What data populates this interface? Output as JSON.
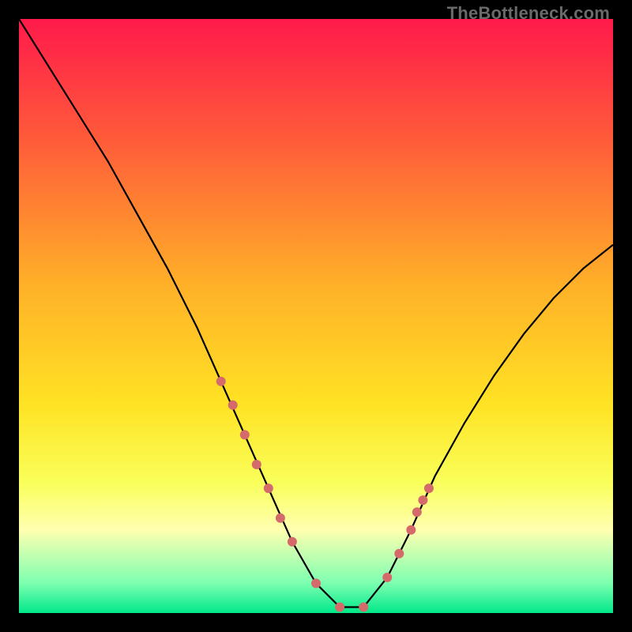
{
  "watermark": "TheBottleneck.com",
  "chart_data": {
    "type": "line",
    "title": "",
    "xlabel": "",
    "ylabel": "",
    "xlim": [
      0,
      100
    ],
    "ylim": [
      0,
      100
    ],
    "series": [
      {
        "name": "bottleneck-curve",
        "x": [
          0,
          5,
          10,
          15,
          20,
          25,
          30,
          34,
          38,
          42,
          46,
          50,
          54,
          58,
          62,
          66,
          70,
          75,
          80,
          85,
          90,
          95,
          100
        ],
        "y": [
          100,
          92,
          84,
          76,
          67,
          58,
          48,
          39,
          30,
          21,
          12,
          5,
          1,
          1,
          6,
          14,
          23,
          32,
          40,
          47,
          53,
          58,
          62
        ]
      }
    ],
    "markers": {
      "name": "highlight-points",
      "color": "#d46a6a",
      "x": [
        34,
        36,
        38,
        40,
        42,
        44,
        46,
        50,
        54,
        58,
        62,
        64,
        66,
        67,
        68,
        69
      ],
      "y": [
        39,
        35,
        30,
        25,
        21,
        16,
        12,
        5,
        1,
        1,
        6,
        10,
        14,
        17,
        19,
        21
      ]
    },
    "background_gradient": {
      "stops": [
        {
          "offset": 0.0,
          "color": "#ff1a4b"
        },
        {
          "offset": 0.2,
          "color": "#ff5a3a"
        },
        {
          "offset": 0.45,
          "color": "#ffb128"
        },
        {
          "offset": 0.65,
          "color": "#ffe324"
        },
        {
          "offset": 0.78,
          "color": "#f9ff5a"
        },
        {
          "offset": 0.86,
          "color": "#ffffb0"
        },
        {
          "offset": 0.95,
          "color": "#7cffb0"
        },
        {
          "offset": 1.0,
          "color": "#00e88a"
        }
      ]
    }
  }
}
